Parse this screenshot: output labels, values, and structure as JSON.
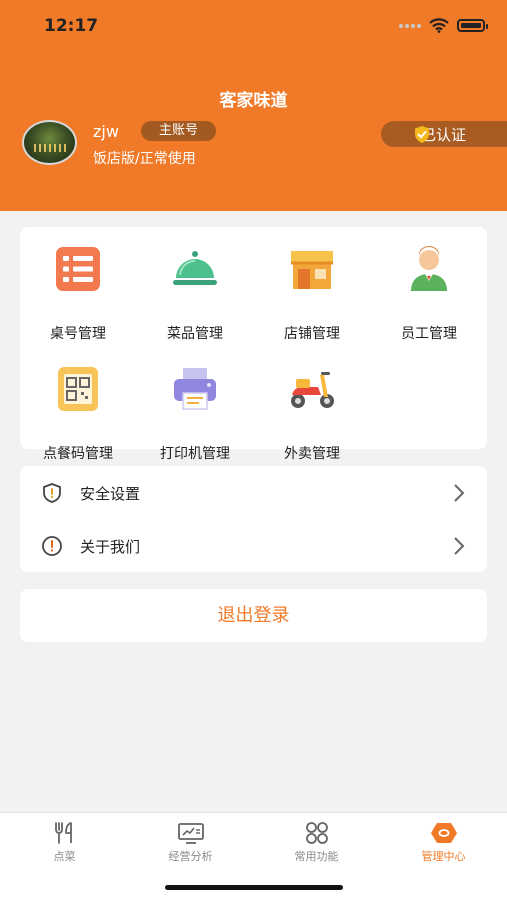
{
  "status_bar": {
    "time": "12:17"
  },
  "header": {
    "shop_name": "客家味道",
    "username": "zjw",
    "account_badge": "主账号",
    "subtitle": "饭店版/正常使用",
    "verified_label": "已认证"
  },
  "grid": [
    {
      "label": "桌号管理",
      "icon": "table-list-icon"
    },
    {
      "label": "菜品管理",
      "icon": "dish-cover-icon"
    },
    {
      "label": "店铺管理",
      "icon": "storefront-icon"
    },
    {
      "label": "员工管理",
      "icon": "staff-person-icon"
    },
    {
      "label": "点餐码管理",
      "icon": "qr-code-icon"
    },
    {
      "label": "打印机管理",
      "icon": "printer-icon"
    },
    {
      "label": "外卖管理",
      "icon": "scooter-icon"
    }
  ],
  "menu": [
    {
      "label": "安全设置",
      "icon": "shield-icon"
    },
    {
      "label": "关于我们",
      "icon": "info-icon"
    }
  ],
  "logout_label": "退出登录",
  "tabs": [
    {
      "label": "点菜",
      "icon": "fork-knife-icon",
      "active": false
    },
    {
      "label": "经营分析",
      "icon": "analytics-icon",
      "active": false
    },
    {
      "label": "常用功能",
      "icon": "grid-apps-icon",
      "active": false
    },
    {
      "label": "管理中心",
      "icon": "management-icon",
      "active": true
    }
  ],
  "colors": {
    "accent": "#f07a28",
    "badge": "#a35a20",
    "background": "#f2f2f2"
  }
}
